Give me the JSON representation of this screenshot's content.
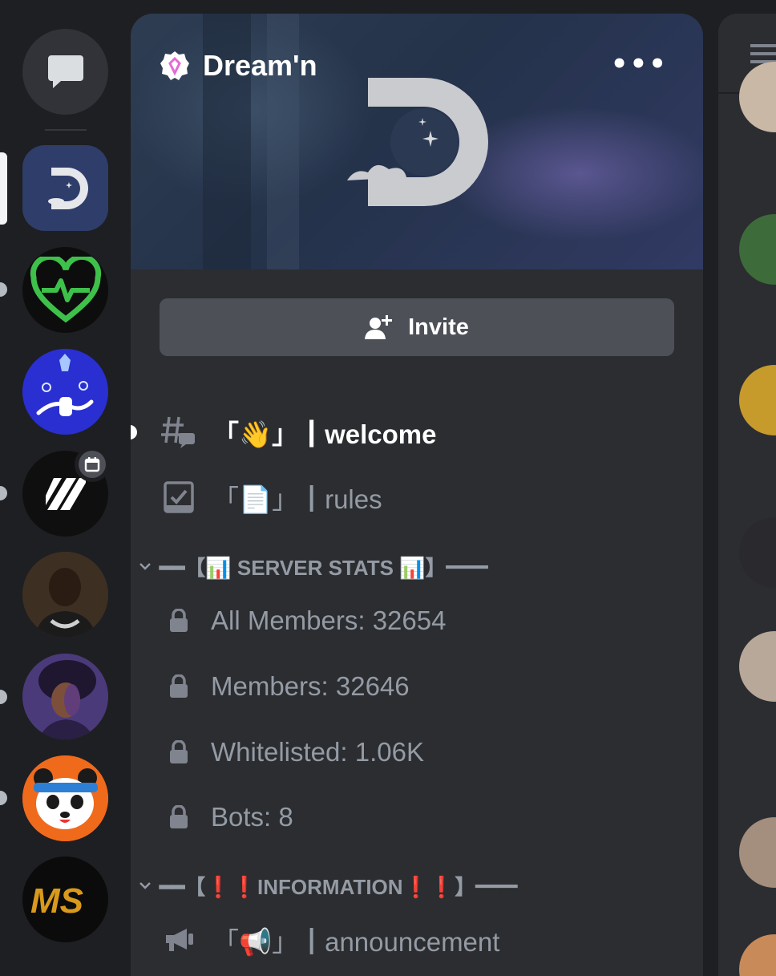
{
  "server": {
    "name": "Dream'n"
  },
  "header": {
    "more_label": "•••"
  },
  "invite": {
    "label": "Invite"
  },
  "channels": [
    {
      "prefix": "「👋」",
      "name": "welcome"
    },
    {
      "prefix": "「📄」",
      "name": "rules"
    }
  ],
  "categories": [
    {
      "name": "━━【📊 SERVER STATS 📊】━━"
    },
    {
      "name": "━━【❗❗INFORMATION❗❗】━━"
    }
  ],
  "stats": [
    {
      "label": "All Members: 32654"
    },
    {
      "label": "Members: 32646"
    },
    {
      "label": "Whitelisted: 1.06K"
    },
    {
      "label": "Bots: 8"
    }
  ],
  "info_channels": [
    {
      "prefix": "「📢」",
      "name": "announcement"
    }
  ],
  "colors": {
    "rail_bg": "#1e1f22",
    "panel_bg": "#2b2d31",
    "muted_text": "#949ba4",
    "button_bg": "#4e5058"
  },
  "icons": {
    "dm": "chat-bubble-icon",
    "invite": "add-person-icon",
    "text_channel": "hashtag-thread-icon",
    "rules": "rules-checkbook-icon",
    "locked": "lock-icon",
    "announcement": "megaphone-icon",
    "event": "calendar-icon"
  }
}
